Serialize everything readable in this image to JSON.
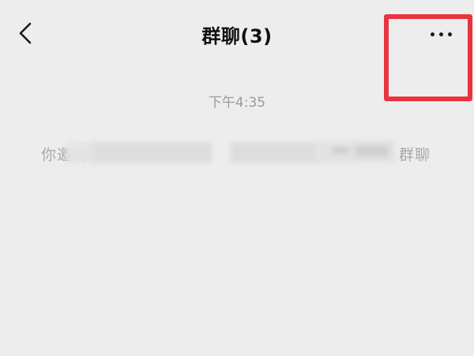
{
  "navbar": {
    "title": "群聊(3)",
    "back_icon": "chevron-left-icon",
    "more_icon": "more-horizontal-icon"
  },
  "chat": {
    "timestamp": "下午4:35",
    "system_message": {
      "prefix": "你邀请",
      "suffix": "群聊"
    }
  },
  "colors": {
    "background": "#ededed",
    "highlight": "#e8343f",
    "title": "#111111",
    "muted_text": "#a8a8a8"
  }
}
